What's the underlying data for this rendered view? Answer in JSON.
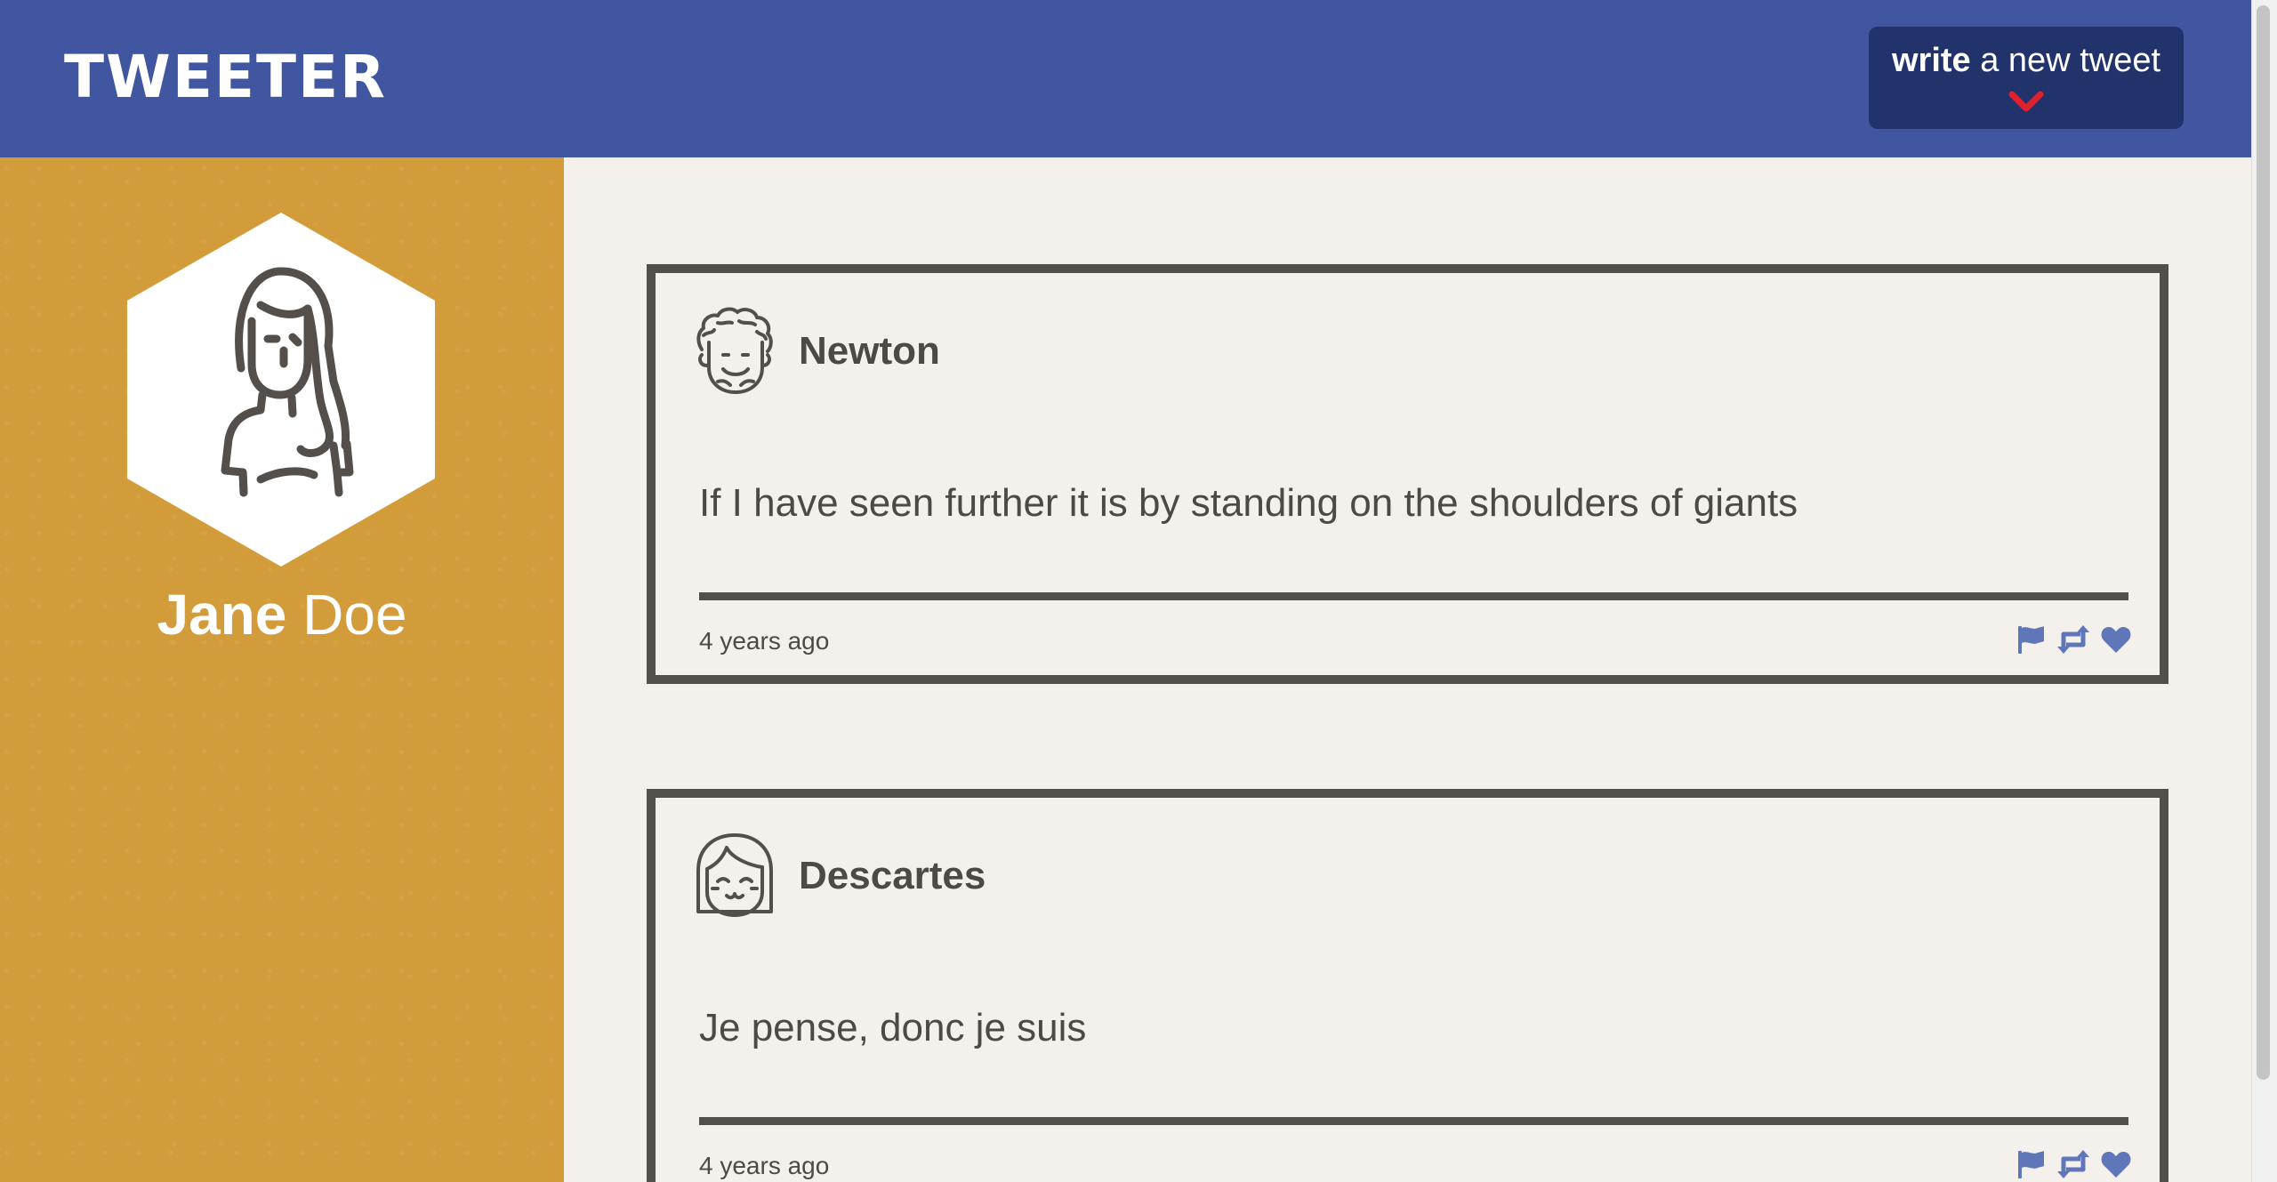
{
  "header": {
    "brand": "TWEETER",
    "compose_button": {
      "strong_label": "write",
      "label_rest": " a new tweet",
      "icon": "chevron-down-icon"
    }
  },
  "profile": {
    "avatar_icon": "girl-avatar-icon",
    "first_name": "Jane",
    "last_name": " Doe"
  },
  "tweets": [
    {
      "avatar_icon": "curly-hair-avatar-icon",
      "author": "Newton",
      "text": "If I have seen further it is by standing on the shoulders of giants",
      "time": "4 years ago",
      "actions": [
        "flag-icon",
        "retweet-icon",
        "heart-icon"
      ]
    },
    {
      "avatar_icon": "bob-hair-avatar-icon",
      "author": "Descartes",
      "text": "Je pense, donc je suis",
      "time": "4 years ago",
      "actions": [
        "flag-icon",
        "retweet-icon",
        "heart-icon"
      ]
    }
  ],
  "colors": {
    "header_bg": "#4056a0",
    "compose_bg": "#22336c",
    "chevron": "#e0202a",
    "sidebar_bg": "#d39c3b",
    "page_bg": "#f4f1ec",
    "tweet_border": "#544f4a",
    "text": "#4e4944",
    "action_icon": "#5f77b8"
  }
}
